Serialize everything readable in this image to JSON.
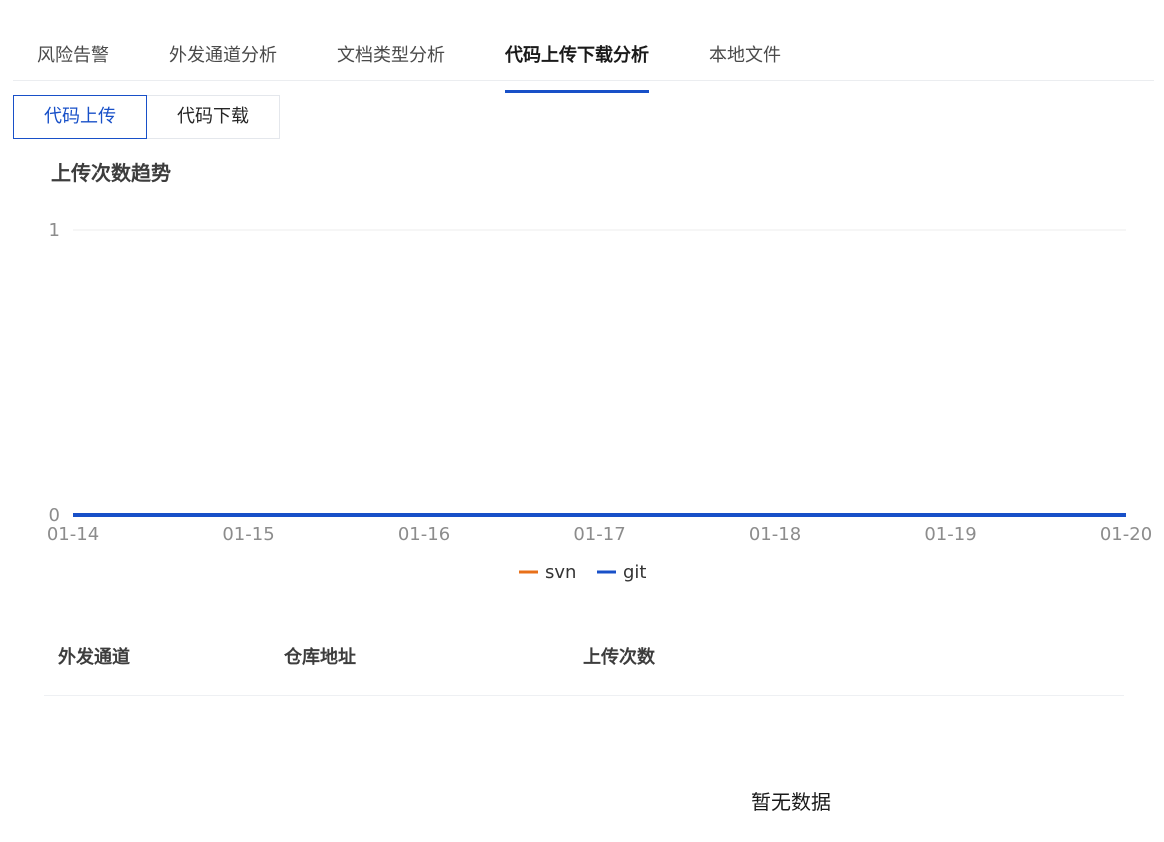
{
  "tabs": [
    {
      "label": "风险告警",
      "active": false
    },
    {
      "label": "外发通道分析",
      "active": false
    },
    {
      "label": "文档类型分析",
      "active": false
    },
    {
      "label": "代码上传下载分析",
      "active": true
    },
    {
      "label": "本地文件",
      "active": false
    }
  ],
  "mode_buttons": {
    "upload_label": "代码上传",
    "download_label": "代码下载",
    "selected": "代码上传"
  },
  "chart_data": {
    "type": "line",
    "title": "上传次数趋势",
    "categories": [
      "01-14",
      "01-15",
      "01-16",
      "01-17",
      "01-18",
      "01-19",
      "01-20"
    ],
    "yticks": [
      "0",
      "1"
    ],
    "ylim": [
      0,
      1
    ],
    "grid": true,
    "legend_position": "bottom-center",
    "series": [
      {
        "name": "svn",
        "values": [
          0,
          0,
          0,
          0,
          0,
          0,
          0
        ],
        "color": "#e8701a"
      },
      {
        "name": "git",
        "values": [
          0,
          0,
          0,
          0,
          0,
          0,
          0
        ],
        "color": "#1850c8"
      }
    ]
  },
  "table": {
    "columns": [
      "外发通道",
      "仓库地址",
      "上传次数"
    ],
    "rows": [],
    "empty_text": "暂无数据"
  }
}
